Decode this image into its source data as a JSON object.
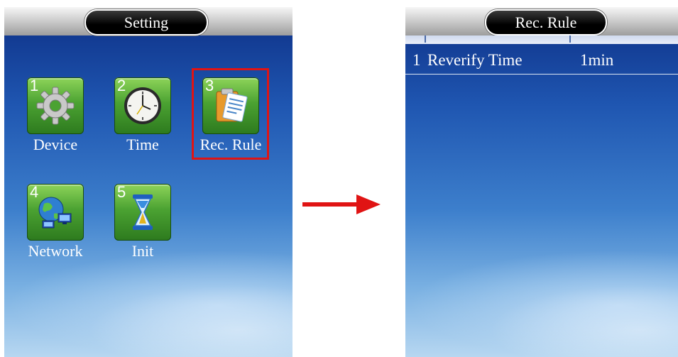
{
  "left_screen": {
    "title": "Setting",
    "items": [
      {
        "number": "1",
        "label": "Device",
        "icon": "gear-icon"
      },
      {
        "number": "2",
        "label": "Time",
        "icon": "clock-icon"
      },
      {
        "number": "3",
        "label": "Rec. Rule",
        "icon": "clipboard-icon"
      },
      {
        "number": "4",
        "label": "Network",
        "icon": "network-globe-icon"
      },
      {
        "number": "5",
        "label": "Init",
        "icon": "hourglass-icon"
      }
    ],
    "selected_item": "Rec. Rule",
    "highlight_color": "#e01414"
  },
  "transition_arrow": {
    "icon": "right-arrow-icon",
    "color": "#e01414"
  },
  "right_screen": {
    "title": "Rec. Rule",
    "rows": [
      {
        "index": "1",
        "name": "Reverify Time",
        "value": "1min"
      }
    ]
  },
  "colors": {
    "background_top": "#0d2f85",
    "background_bottom": "#b7d7f1",
    "title_pill": "#000000",
    "icon_tile": "#4ba232"
  }
}
